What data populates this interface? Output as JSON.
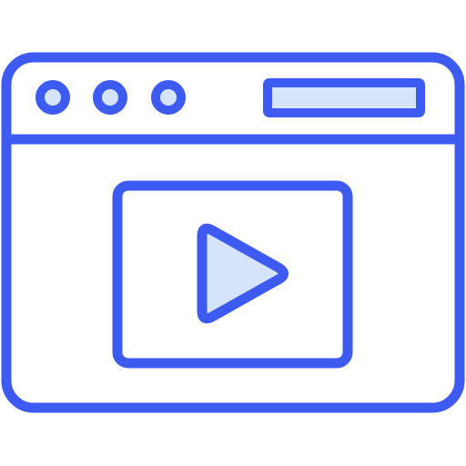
{
  "icon": {
    "name": "video-player-window-icon",
    "stroke_color": "#3d5af1",
    "fill_color": "#d6e4fb",
    "background_color": "#ffffff"
  },
  "window": {
    "title_bar": {
      "controls": [
        {
          "name": "window-dot-1-icon"
        },
        {
          "name": "window-dot-2-icon"
        },
        {
          "name": "window-dot-3-icon"
        }
      ],
      "address_bar": {
        "name": "address-bar-icon"
      }
    },
    "content": {
      "video_frame": {
        "name": "video-frame-icon"
      },
      "play_button": {
        "name": "play-triangle-icon"
      }
    }
  }
}
